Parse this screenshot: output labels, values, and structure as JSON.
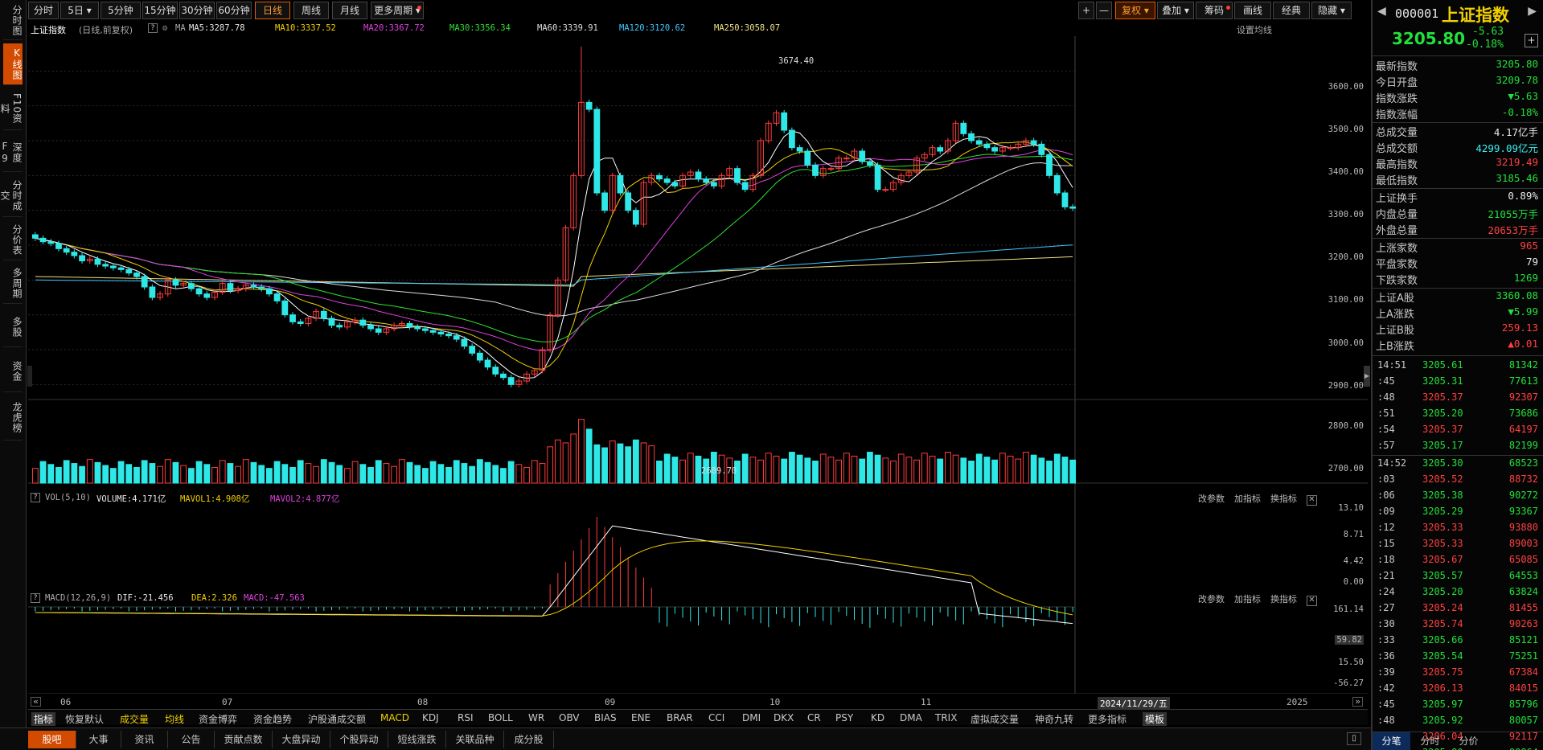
{
  "left_tabs": [
    {
      "label": "分时图",
      "active": false
    },
    {
      "label": "K线图",
      "active": true
    },
    {
      "label": "F10资料",
      "active": false
    },
    {
      "label": "深度F9",
      "active": false
    },
    {
      "label": "分时成交",
      "active": false
    },
    {
      "label": "分价表",
      "active": false
    },
    {
      "label": "多周期",
      "active": false
    },
    {
      "label": "多股",
      "active": false
    },
    {
      "label": "资金",
      "active": false
    },
    {
      "label": "龙虎榜",
      "active": false
    }
  ],
  "toolbar": {
    "periods": [
      "分时",
      "5日",
      "5分钟",
      "15分钟",
      "30分钟",
      "60分钟",
      "日线",
      "周线",
      "月线",
      "更多周期"
    ],
    "active_period": "日线",
    "right_buttons": [
      "+",
      "—",
      "复权",
      "叠加",
      "筹码",
      "画线",
      "经典",
      "隐藏"
    ]
  },
  "chart_header": {
    "name": "上证指数",
    "mode": "(日线,前复权)",
    "ma_label": "MA",
    "ma5": "MA5:3287.78",
    "ma10": "MA10:3337.52",
    "ma20": "MA20:3367.72",
    "ma30": "MA30:3356.34",
    "ma60": "MA60:3339.91",
    "ma120": "MA120:3120.62",
    "ma250": "MA250:3058.07",
    "settings": "设置均线"
  },
  "price_axis": [
    "3600.00",
    "3500.00",
    "3400.00",
    "3300.00",
    "3200.00",
    "3100.00",
    "3000.00",
    "2900.00",
    "2800.00",
    "2700.00"
  ],
  "price_marks": {
    "high": "3674.40",
    "low": "2689.70"
  },
  "volume_header": {
    "name": "VOL(5,10)",
    "volume": "VOLUME:4.171亿",
    "mavol1": "MAVOL1:4.908亿",
    "mavol2": "MAVOL2:4.877亿",
    "links": [
      "改参数",
      "加指标",
      "换指标"
    ]
  },
  "volume_axis": [
    "13.10",
    "8.71",
    "4.42",
    "0.00"
  ],
  "macd_header": {
    "name": "MACD(12,26,9)",
    "dif": "DIF:-21.456",
    "dea": "DEA:2.326",
    "macd": "MACD:-47.563",
    "links": [
      "改参数",
      "加指标",
      "换指标"
    ]
  },
  "macd_axis": [
    "161.14",
    "59.82",
    "15.50",
    "-56.27"
  ],
  "x_axis": [
    "06",
    "07",
    "08",
    "09",
    "10",
    "11",
    "2024/11/29/五",
    "2025"
  ],
  "indicator_bar": [
    "指标",
    "恢复默认",
    "成交量",
    "均线",
    "资金博弈",
    "资金趋势",
    "沪股通成交额",
    "MACD",
    "KDJ",
    "RSI",
    "BOLL",
    "WR",
    "OBV",
    "BIAS",
    "ENE",
    "BRAR",
    "CCI",
    "DMI",
    "DKX",
    "CR",
    "PSY",
    "KD",
    "DMA",
    "TRIX",
    "虚拟成交量",
    "神奇九转",
    "更多指标",
    "模板"
  ],
  "bottom_tabs": [
    "股吧",
    "大事",
    "资讯",
    "公告",
    "贡献点数",
    "大盘异动",
    "个股异动",
    "短线涨跌",
    "关联品种",
    "成分股"
  ],
  "quote": {
    "code": "000001",
    "name": "上证指数",
    "price": "3205.80",
    "change": "-5.63",
    "change_pct": "-0.18%"
  },
  "stats": [
    {
      "label": "最新指数",
      "value": "3205.80",
      "color": "dn"
    },
    {
      "label": "今日开盘",
      "value": "3209.78",
      "color": "dn"
    },
    {
      "label": "指数涨跌",
      "value": "▼5.63",
      "color": "dn"
    },
    {
      "label": "指数涨幅",
      "value": "-0.18%",
      "color": "dn"
    },
    {
      "label": "总成交量",
      "value": "4.17亿手",
      "color": "wh"
    },
    {
      "label": "总成交额",
      "value": "4299.09亿元",
      "color": "cy"
    },
    {
      "label": "最高指数",
      "value": "3219.49",
      "color": "up"
    },
    {
      "label": "最低指数",
      "value": "3185.46",
      "color": "dn"
    },
    {
      "label": "上证换手",
      "value": "0.89%",
      "color": "wh"
    },
    {
      "label": "内盘总量",
      "value": "21055万手",
      "color": "dn"
    },
    {
      "label": "外盘总量",
      "value": "20653万手",
      "color": "up"
    },
    {
      "label": "上涨家数",
      "value": "965",
      "color": "up"
    },
    {
      "label": "平盘家数",
      "value": "79",
      "color": "wh"
    },
    {
      "label": "下跌家数",
      "value": "1269",
      "color": "dn"
    },
    {
      "label": "上证A股",
      "value": "3360.08",
      "color": "dn"
    },
    {
      "label": "上A涨跌",
      "value": "▼5.99",
      "color": "dn"
    },
    {
      "label": "上证B股",
      "value": "259.13",
      "color": "up"
    },
    {
      "label": "上B涨跌",
      "value": "▲0.01",
      "color": "up"
    }
  ],
  "ticks": [
    {
      "t": "14:51",
      "p": "3205.61",
      "v": "81342",
      "c": "dn"
    },
    {
      "t": ":45",
      "p": "3205.31",
      "v": "77613",
      "c": "dn"
    },
    {
      "t": ":48",
      "p": "3205.37",
      "v": "92307",
      "c": "up"
    },
    {
      "t": ":51",
      "p": "3205.20",
      "v": "73686",
      "c": "dn"
    },
    {
      "t": ":54",
      "p": "3205.37",
      "v": "64197",
      "c": "up"
    },
    {
      "t": ":57",
      "p": "3205.17",
      "v": "82199",
      "c": "dn"
    },
    {
      "t": "14:52",
      "p": "3205.30",
      "v": "68523",
      "c": "dn"
    },
    {
      "t": ":03",
      "p": "3205.52",
      "v": "88732",
      "c": "up"
    },
    {
      "t": ":06",
      "p": "3205.38",
      "v": "90272",
      "c": "dn"
    },
    {
      "t": ":09",
      "p": "3205.29",
      "v": "93367",
      "c": "dn"
    },
    {
      "t": ":12",
      "p": "3205.33",
      "v": "93880",
      "c": "up"
    },
    {
      "t": ":15",
      "p": "3205.33",
      "v": "89003",
      "c": "up"
    },
    {
      "t": ":18",
      "p": "3205.67",
      "v": "65085",
      "c": "up"
    },
    {
      "t": ":21",
      "p": "3205.57",
      "v": "64553",
      "c": "dn"
    },
    {
      "t": ":24",
      "p": "3205.20",
      "v": "63824",
      "c": "dn"
    },
    {
      "t": ":27",
      "p": "3205.24",
      "v": "81455",
      "c": "up"
    },
    {
      "t": ":30",
      "p": "3205.74",
      "v": "90263",
      "c": "up"
    },
    {
      "t": ":33",
      "p": "3205.66",
      "v": "85121",
      "c": "dn"
    },
    {
      "t": ":36",
      "p": "3205.54",
      "v": "75251",
      "c": "dn"
    },
    {
      "t": ":39",
      "p": "3205.75",
      "v": "67384",
      "c": "up"
    },
    {
      "t": ":42",
      "p": "3206.13",
      "v": "84015",
      "c": "up"
    },
    {
      "t": ":45",
      "p": "3205.97",
      "v": "85796",
      "c": "dn"
    },
    {
      "t": ":48",
      "p": "3205.92",
      "v": "80057",
      "c": "dn"
    },
    {
      "t": ":51",
      "p": "3206.04",
      "v": "92117",
      "c": "up"
    },
    {
      "t": ":54",
      "p": "3205.80",
      "v": "88864",
      "c": "dn"
    }
  ],
  "right_tabs": [
    "分笔",
    "分时",
    "分价"
  ],
  "chart_data": {
    "type": "candlestick",
    "title": "上证指数",
    "price_range": [
      2650,
      3700
    ],
    "high_point": 3674.4,
    "low_point": 2689.7,
    "closes": [
      3120,
      3110,
      3105,
      3090,
      3080,
      3070,
      3055,
      3060,
      3045,
      3040,
      3035,
      3030,
      3020,
      3010,
      2980,
      2950,
      2960,
      3000,
      2985,
      2990,
      2975,
      2960,
      2950,
      2965,
      2990,
      2970,
      2975,
      2985,
      2980,
      2975,
      2960,
      2940,
      2900,
      2880,
      2875,
      2890,
      2910,
      2890,
      2870,
      2865,
      2880,
      2885,
      2870,
      2860,
      2850,
      2860,
      2870,
      2875,
      2865,
      2860,
      2855,
      2850,
      2845,
      2840,
      2830,
      2810,
      2790,
      2770,
      2750,
      2730,
      2720,
      2700,
      2710,
      2730,
      2740,
      2800,
      2900,
      3000,
      3150,
      3300,
      3510,
      3490,
      3250,
      3200,
      3300,
      3250,
      3200,
      3160,
      3280,
      3300,
      3290,
      3280,
      3270,
      3300,
      3310,
      3290,
      3280,
      3270,
      3300,
      3320,
      3280,
      3260,
      3300,
      3400,
      3450,
      3480,
      3430,
      3380,
      3370,
      3330,
      3300,
      3320,
      3320,
      3350,
      3350,
      3370,
      3340,
      3330,
      3260,
      3260,
      3280,
      3300,
      3310,
      3350,
      3360,
      3380,
      3370,
      3400,
      3450,
      3420,
      3400,
      3390,
      3380,
      3370,
      3380,
      3380,
      3390,
      3400,
      3390,
      3360,
      3300,
      3250,
      3210,
      3206
    ]
  }
}
